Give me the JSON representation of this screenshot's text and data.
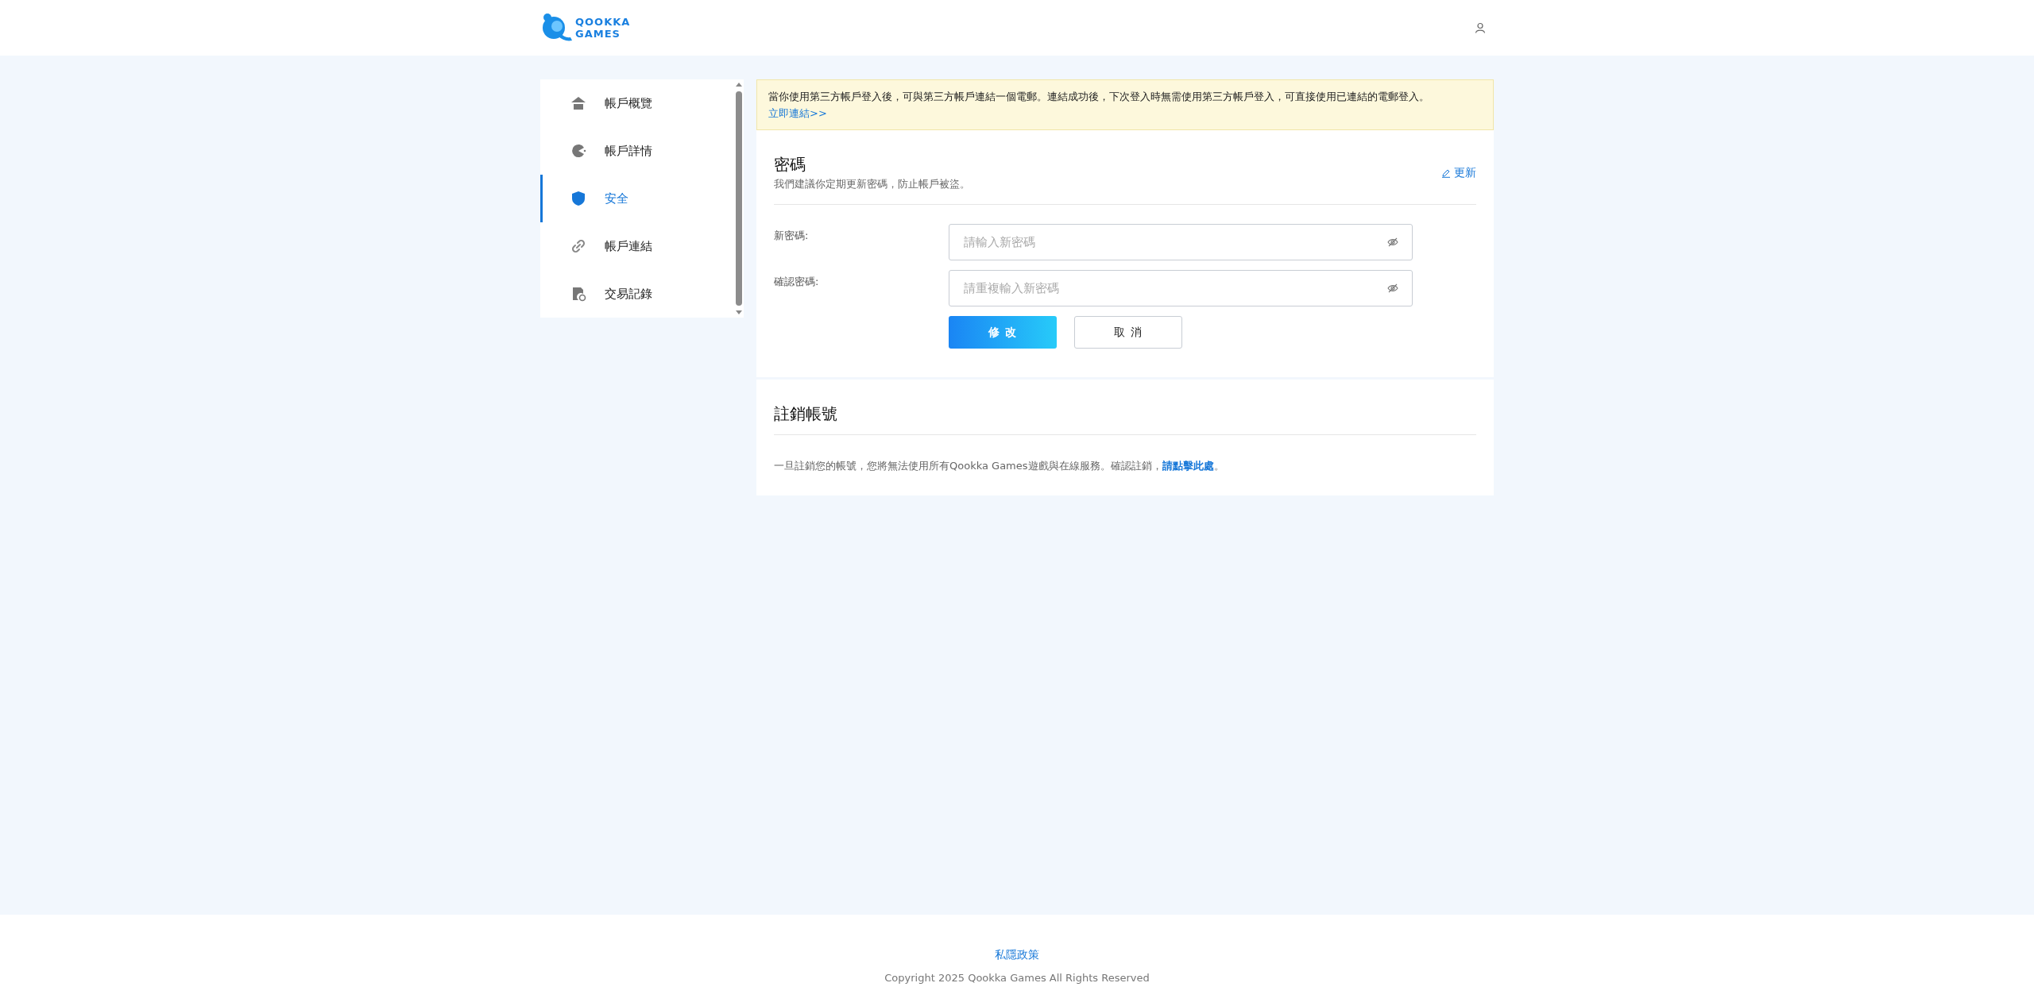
{
  "header": {
    "logo": {
      "line_1": "QOOKKA",
      "line_2": "GAMES"
    }
  },
  "sidebar": {
    "items": [
      {
        "label": "帳戶概覽",
        "selected": false
      },
      {
        "label": "帳戶詳情",
        "selected": false
      },
      {
        "label": "安全",
        "selected": true
      },
      {
        "label": "帳戶連結",
        "selected": false
      },
      {
        "label": "交易記錄",
        "selected": false
      }
    ]
  },
  "notice": {
    "text": "當你使用第三方帳戶登入後，可與第三方帳戶連結一個電郵。連結成功後，下次登入時無需使用第三方帳戶登入，可直接使用已連結的電郵登入。",
    "link": "立即連結>>"
  },
  "password": {
    "title": "密碼",
    "subtitle": "我們建議你定期更新密碼，防止帳戶被盜。",
    "edit": "更新",
    "fields": [
      {
        "label": "新密碼:",
        "placeholder": "請輸入新密碼"
      },
      {
        "label": "確認密碼:",
        "placeholder": "請重複輸入新密碼"
      }
    ],
    "buttons": [
      {
        "label": "修 改",
        "kind": "primary"
      },
      {
        "label": "取 消",
        "kind": "secondary"
      }
    ]
  },
  "delete_account": {
    "title": "註銷帳號",
    "text": "一旦註銷您的帳號，您將無法使用所有Qookka Games遊戲與在線服務。確認註銷，",
    "link": "請點擊此處",
    "end": "。"
  },
  "footer": {
    "link": "私隱政策",
    "copyright": "Copyright 2025 Qookka Games All Rights Reserved"
  }
}
